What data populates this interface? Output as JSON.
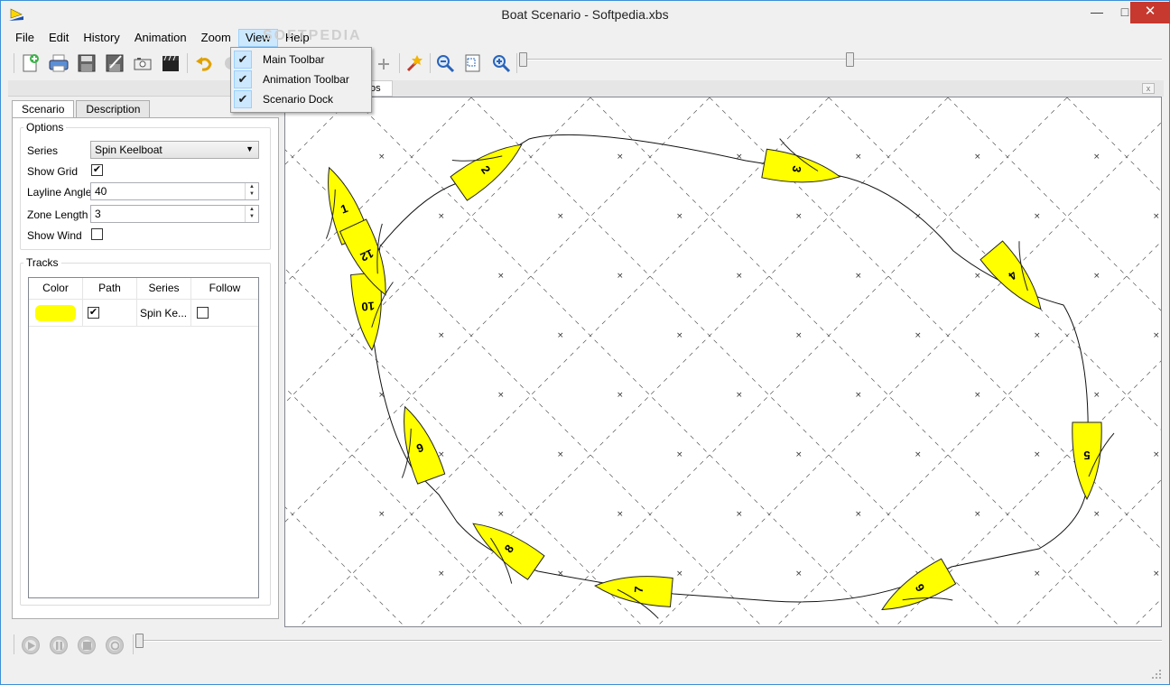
{
  "window": {
    "title": "Boat Scenario - Softpedia.xbs",
    "min_glyph": "—",
    "max_glyph": "□",
    "close_glyph": "✕"
  },
  "menu": {
    "items": [
      "File",
      "Edit",
      "History",
      "Animation",
      "Zoom",
      "View",
      "Help"
    ],
    "active": "View"
  },
  "view_menu": {
    "items": [
      {
        "label": "Main Toolbar",
        "checked": true
      },
      {
        "label": "Animation Toolbar",
        "checked": true
      },
      {
        "label": "Scenario Dock",
        "checked": true
      }
    ],
    "check_glyph": "✔"
  },
  "toolbar": {
    "buttons": [
      "new-file-icon",
      "print-icon",
      "save-icon",
      "save-as-icon",
      "snapshot-icon",
      "video-clapper-icon",
      "undo-icon",
      "redo-icon",
      "add-track-icon",
      "add-mark-icon",
      "wand-icon",
      "zoom-out-icon",
      "fit-page-icon",
      "zoom-in-icon"
    ],
    "zoom_slider_level": 0.505
  },
  "dock": {
    "tabs": [
      "Scenario",
      "Description"
    ],
    "selected_tab": "Scenario",
    "options": {
      "title": "Options",
      "series_label": "Series",
      "series_value": "Spin Keelboat",
      "show_grid_label": "Show Grid",
      "show_grid_checked": true,
      "show_grid_mark": "✔",
      "layline_label": "Layline Angle",
      "layline_value": "40",
      "zone_label": "Zone Length",
      "zone_value": "3",
      "show_wind_label": "Show Wind",
      "show_wind_checked": false,
      "spin_up": "▲",
      "spin_down": "▼",
      "combo_arrow": "▼"
    },
    "tracks": {
      "title": "Tracks",
      "headers": [
        "Color",
        "Path",
        "Series",
        "Follow"
      ],
      "rows": [
        {
          "color": "#ffff00",
          "path_checked": true,
          "path_mark": "✔",
          "series": "Spin Ke...",
          "follow_checked": false
        }
      ]
    }
  },
  "scene": {
    "tab_label": "os",
    "boat_color": "#ffff00",
    "boats": [
      "1",
      "2",
      "3",
      "4",
      "5",
      "6",
      "7",
      "8",
      "9",
      "10",
      "12"
    ]
  },
  "animation_bar": {
    "buttons": [
      "play-icon",
      "pause-icon",
      "stop-icon",
      "loop-icon"
    ],
    "timeline_position": 0
  },
  "watermark": "SOFTPEDIA"
}
